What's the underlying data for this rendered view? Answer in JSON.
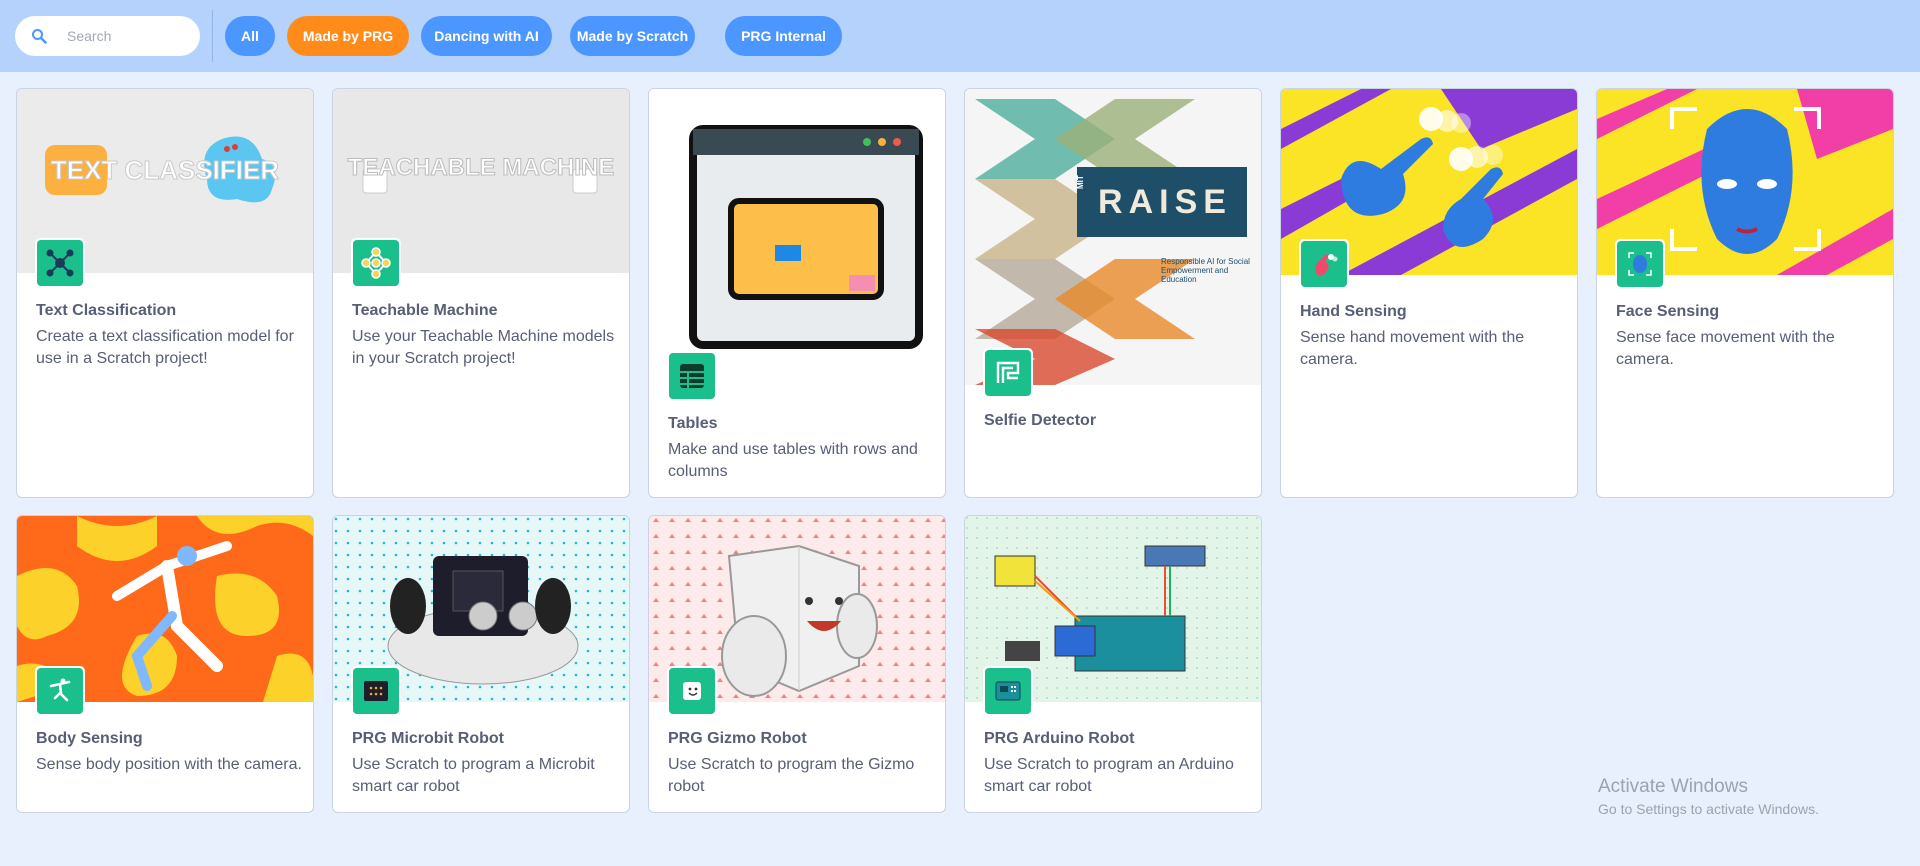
{
  "search": {
    "placeholder": "Search"
  },
  "filters": [
    {
      "label": "All"
    },
    {
      "label": "Made by PRG"
    },
    {
      "label": "Dancing with AI"
    },
    {
      "label": "Made by Scratch"
    },
    {
      "label": "PRG Internal"
    }
  ],
  "active_filter": "Made by PRG",
  "cards": [
    {
      "title": "Text Classification",
      "desc": "Create a text classification model for use in a Scratch project!",
      "art_text": "TEXT CLASSIFIER",
      "icon": "network-icon"
    },
    {
      "title": "Teachable Machine",
      "desc": "Use your Teachable Machine models in your Scratch project!",
      "art_text": "TEACHABLE MACHINE",
      "icon": "network-icon"
    },
    {
      "title": "Tables",
      "desc": "Make and use tables with rows and columns",
      "icon": "table-icon"
    },
    {
      "title": "Selfie Detector",
      "desc": "",
      "art_text": "RAISE",
      "art_mit": "MIT",
      "art_subtitle": "Responsible AI for Social Empowerment and Education",
      "icon": "selfie-icon"
    },
    {
      "title": "Hand Sensing",
      "desc": "Sense hand movement with the camera.",
      "icon": "hand-icon"
    },
    {
      "title": "Face Sensing",
      "desc": "Sense face movement with the camera.",
      "icon": "face-icon"
    },
    {
      "title": "Body Sensing",
      "desc": "Sense body position with the camera.",
      "icon": "body-icon"
    },
    {
      "title": "PRG Microbit Robot",
      "desc": "Use Scratch to program a Microbit smart car robot",
      "icon": "microbit-icon"
    },
    {
      "title": "PRG Gizmo Robot",
      "desc": "Use Scratch to program the Gizmo robot",
      "icon": "gizmo-icon"
    },
    {
      "title": "PRG Arduino Robot",
      "desc": "Use Scratch to program an Arduino smart car robot",
      "icon": "arduino-icon"
    }
  ],
  "watermark": {
    "title": "Activate Windows",
    "subtitle": "Go to Settings to activate Windows."
  },
  "colors": {
    "topbar": "#b5d2fd",
    "pill": "#4c97ff",
    "pill_active": "#ff8c1a",
    "icon_green": "#1bbf8b",
    "text": "#575e75"
  }
}
